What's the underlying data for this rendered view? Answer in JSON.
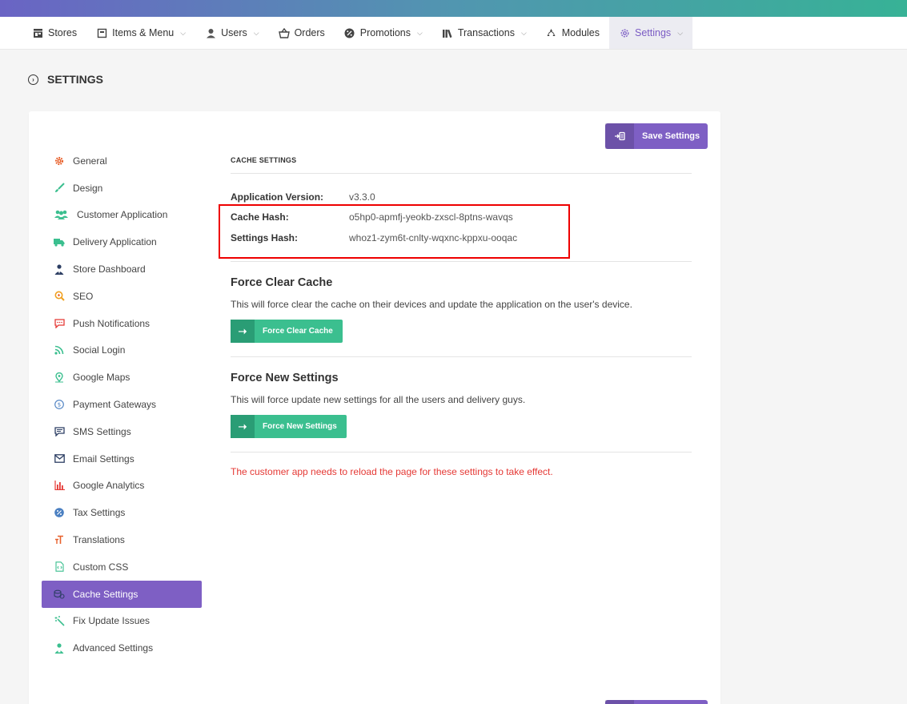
{
  "nav": {
    "items": [
      {
        "label": "Stores",
        "icon": "store-icon",
        "dropdown": false
      },
      {
        "label": "Items & Menu",
        "icon": "menu-book-icon",
        "dropdown": true
      },
      {
        "label": "Users",
        "icon": "user-icon",
        "dropdown": true
      },
      {
        "label": "Orders",
        "icon": "basket-icon",
        "dropdown": false
      },
      {
        "label": "Promotions",
        "icon": "percent-icon",
        "dropdown": true
      },
      {
        "label": "Transactions",
        "icon": "library-icon",
        "dropdown": true
      },
      {
        "label": "Modules",
        "icon": "modules-icon",
        "dropdown": false
      },
      {
        "label": "Settings",
        "icon": "gear-icon",
        "dropdown": true,
        "active": true
      }
    ]
  },
  "page": {
    "title": "SETTINGS"
  },
  "toolbar": {
    "save_label": "Save Settings"
  },
  "sidebar": {
    "items": [
      {
        "label": "General",
        "icon": "gear-icon"
      },
      {
        "label": "Design",
        "icon": "brush-icon"
      },
      {
        "label": "Customer Application",
        "icon": "users-icon"
      },
      {
        "label": "Delivery Application",
        "icon": "truck-icon"
      },
      {
        "label": "Store Dashboard",
        "icon": "user-tie-icon"
      },
      {
        "label": "SEO",
        "icon": "search-icon"
      },
      {
        "label": "Push Notifications",
        "icon": "chat-icon"
      },
      {
        "label": "Social Login",
        "icon": "rss-icon"
      },
      {
        "label": "Google Maps",
        "icon": "map-pin-icon"
      },
      {
        "label": "Payment Gateways",
        "icon": "dollar-icon"
      },
      {
        "label": "SMS Settings",
        "icon": "sms-icon"
      },
      {
        "label": "Email Settings",
        "icon": "mail-icon"
      },
      {
        "label": "Google Analytics",
        "icon": "bar-chart-icon"
      },
      {
        "label": "Tax Settings",
        "icon": "percent-icon"
      },
      {
        "label": "Translations",
        "icon": "text-size-icon"
      },
      {
        "label": "Custom CSS",
        "icon": "code-file-icon"
      },
      {
        "label": "Cache Settings",
        "icon": "cache-icon",
        "active": true
      },
      {
        "label": "Fix Update Issues",
        "icon": "magic-wand-icon"
      },
      {
        "label": "Advanced Settings",
        "icon": "user-settings-icon"
      }
    ]
  },
  "cache": {
    "section_label": "CACHE SETTINGS",
    "rows": [
      {
        "key": "Application Version:",
        "value": "v3.3.0"
      },
      {
        "key": "Cache Hash:",
        "value": "o5hp0-apmfj-yeokb-zxscl-8ptns-wavqs"
      },
      {
        "key": "Settings Hash:",
        "value": "whoz1-zym6t-cnlty-wqxnc-kppxu-ooqac"
      }
    ],
    "force_clear": {
      "title": "Force Clear Cache",
      "description": "This will force clear the cache on their devices and update the application on the user's device.",
      "button": "Force Clear Cache"
    },
    "force_settings": {
      "title": "Force New Settings",
      "description": "This will force update new settings for all the users and delivery guys.",
      "button": "Force New Settings"
    },
    "warning": "The customer app needs to reload the page for these settings to take effect."
  },
  "colors": {
    "accent": "#7e5fc4",
    "green": "#3bbf8f",
    "warning": "#e53935",
    "highlight": "#ee0000"
  }
}
